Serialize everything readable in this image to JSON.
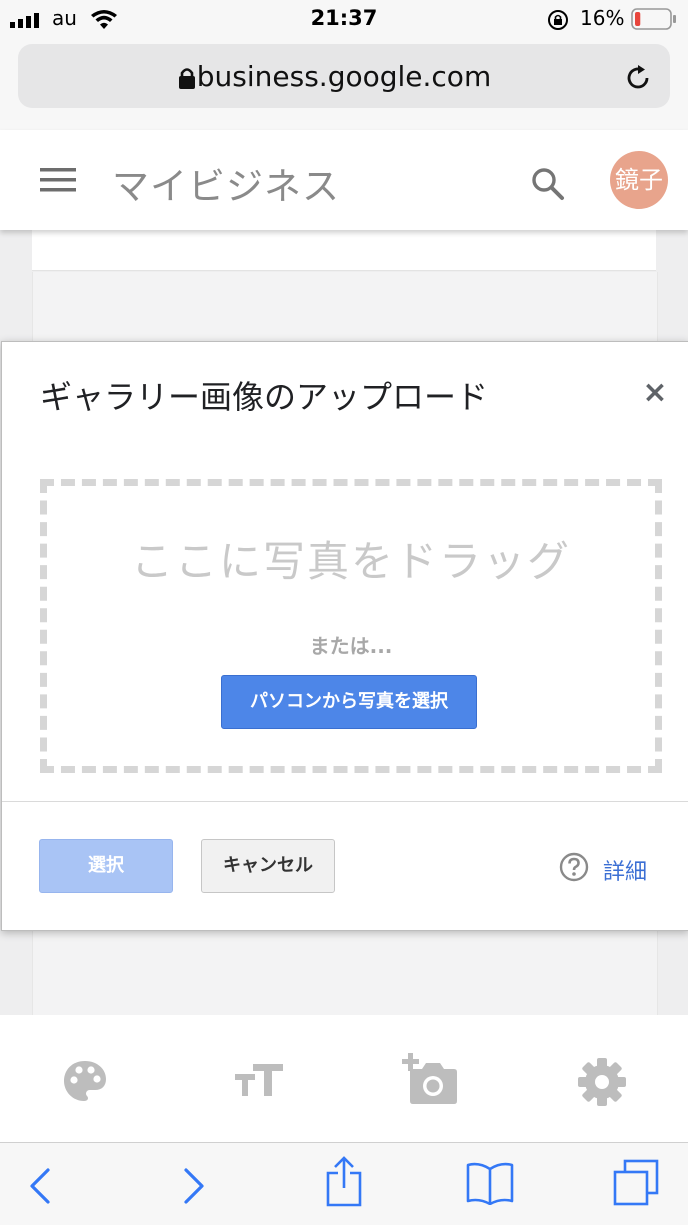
{
  "status_bar": {
    "carrier": "au",
    "time": "21:37",
    "battery_percent_text": "16%",
    "battery_level": 0.16
  },
  "browser": {
    "url": "business.google.com"
  },
  "app_header": {
    "title": "マイビジネス",
    "avatar_text": "鏡子"
  },
  "dialog": {
    "title": "ギャラリー画像のアップロード",
    "close_label": "×",
    "drag_text": "ここに写真をドラッグ",
    "or_text": "または...",
    "choose_button": "パソコンから写真を選択",
    "select_button": "選択",
    "cancel_button": "キャンセル",
    "help_link": "詳細"
  },
  "colors": {
    "primary_blue": "#4d86e8",
    "disabled_blue": "#a9c4f5",
    "link_blue": "#3b6fd4",
    "avatar_bg": "#e8a48c",
    "ios_blue": "#3478f6"
  },
  "toolbar_icons": [
    "palette-icon",
    "text-size-icon",
    "add-photo-icon",
    "settings-icon"
  ],
  "safari_icons": [
    "back-icon",
    "forward-icon",
    "share-icon",
    "bookmarks-icon",
    "tabs-icon"
  ]
}
